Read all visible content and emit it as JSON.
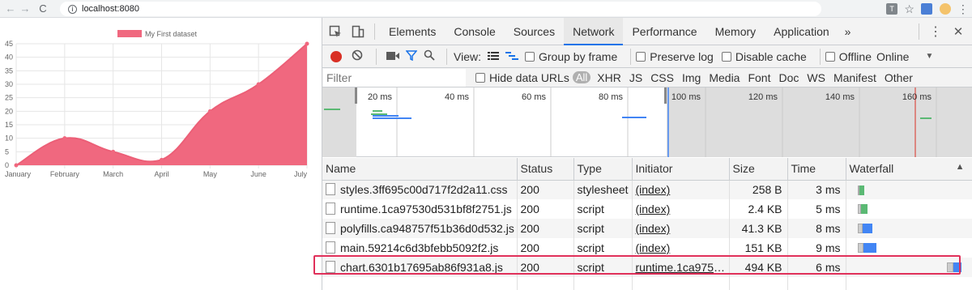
{
  "browser": {
    "url": "localhost:8080",
    "back": "←",
    "forward": "→",
    "reload": "C",
    "info": "i",
    "translate": "T",
    "star": "☆",
    "menu": "⋮"
  },
  "chart_data": {
    "type": "area",
    "categories": [
      "January",
      "February",
      "March",
      "April",
      "May",
      "June",
      "July"
    ],
    "series": [
      {
        "name": "My First dataset",
        "values": [
          0,
          10,
          5,
          2,
          20,
          30,
          45
        ],
        "color": "#f0687f"
      }
    ],
    "ylim": [
      0,
      45
    ],
    "yticks": [
      "0",
      "5",
      "10",
      "15",
      "20",
      "25",
      "30",
      "35",
      "40",
      "45"
    ],
    "grid": true,
    "legend": "top"
  },
  "devtools": {
    "tabs": [
      "Elements",
      "Console",
      "Sources",
      "Network",
      "Performance",
      "Memory",
      "Application"
    ],
    "active_tab": "Network",
    "more": "»",
    "kebab": "⋮",
    "close": "✕",
    "toolbar": {
      "view_label": "View:",
      "group_by_frame": "Group by frame",
      "preserve_log": "Preserve log",
      "disable_cache": "Disable cache",
      "offline": "Offline",
      "throttle": "Online",
      "throttle_arrow": "▼"
    },
    "filter": {
      "placeholder": "Filter",
      "hide_data_urls": "Hide data URLs",
      "types": [
        "All",
        "XHR",
        "JS",
        "CSS",
        "Img",
        "Media",
        "Font",
        "Doc",
        "WS",
        "Manifest",
        "Other"
      ]
    },
    "overview_ticks": [
      "20 ms",
      "40 ms",
      "60 ms",
      "80 ms",
      "100 ms",
      "120 ms",
      "140 ms",
      "160 ms"
    ],
    "table": {
      "headers": [
        "Name",
        "Status",
        "Type",
        "Initiator",
        "Size",
        "Time",
        "Waterfall"
      ],
      "sort_arrow": "▲",
      "rows": [
        {
          "name": "styles.3ff695c00d717f2d2a11.css",
          "status": "200",
          "type": "stylesheet",
          "initiator": "(index)",
          "size": "258 B",
          "time": "3 ms"
        },
        {
          "name": "runtime.1ca97530d531bf8f2751.js",
          "status": "200",
          "type": "script",
          "initiator": "(index)",
          "size": "2.4 KB",
          "time": "5 ms"
        },
        {
          "name": "polyfills.ca948757f51b36d0d532.js",
          "status": "200",
          "type": "script",
          "initiator": "(index)",
          "size": "41.3 KB",
          "time": "8 ms"
        },
        {
          "name": "main.59214c6d3bfebb5092f2.js",
          "status": "200",
          "type": "script",
          "initiator": "(index)",
          "size": "151 KB",
          "time": "9 ms"
        },
        {
          "name": "chart.6301b17695ab86f931a8.js",
          "status": "200",
          "type": "script",
          "initiator": "runtime.1ca9753…",
          "size": "494 KB",
          "time": "6 ms"
        }
      ]
    }
  }
}
